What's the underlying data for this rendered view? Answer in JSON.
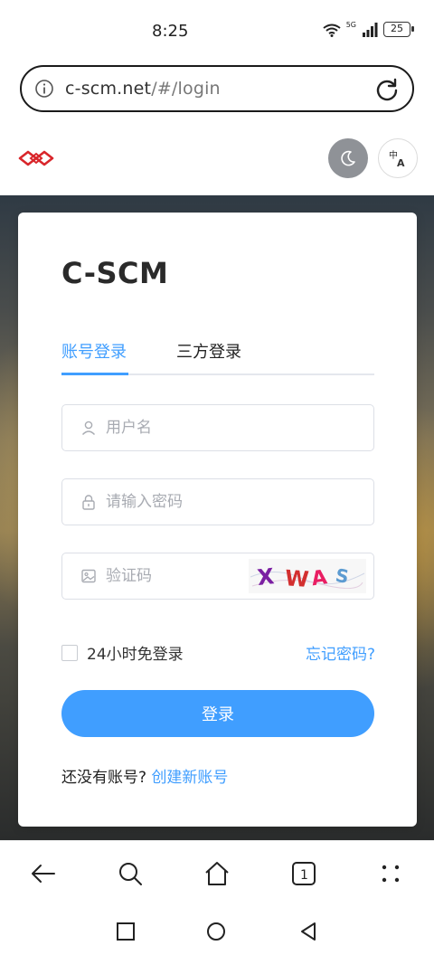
{
  "status_bar": {
    "time": "8:25",
    "battery": "25",
    "network": "5G"
  },
  "browser": {
    "url_host": "c-scm.net",
    "url_path": "/#/login"
  },
  "site": {
    "logo_icon": "brand-logo-icon",
    "theme_icon": "moon-icon",
    "lang_icon": "translate-icon"
  },
  "login": {
    "title": "C-SCM",
    "tabs": [
      {
        "label": "账号登录",
        "active": true
      },
      {
        "label": "三方登录",
        "active": false
      }
    ],
    "username_placeholder": "用户名",
    "password_placeholder": "请输入密码",
    "captcha_placeholder": "验证码",
    "captcha_text": "XWAS",
    "remember_label": "24小时免登录",
    "forgot_label": "忘记密码?",
    "submit_label": "登录",
    "signup_prompt": "还没有账号?",
    "signup_link": "创建新账号"
  },
  "colors": {
    "accent": "#409eff",
    "theme_button": "#8f9297",
    "logo_red": "#d9262b"
  }
}
